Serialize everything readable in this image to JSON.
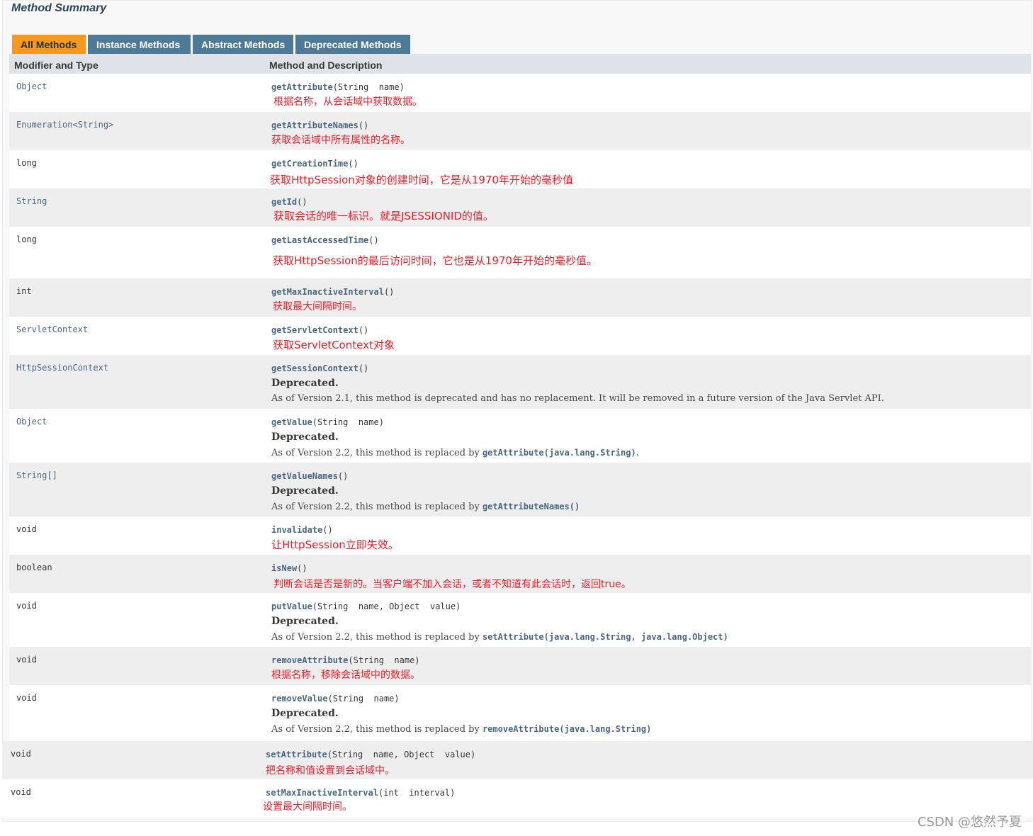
{
  "section_title": "Method Summary",
  "tabs": [
    {
      "label": "All Methods"
    },
    {
      "label": "Instance Methods"
    },
    {
      "label": "Abstract Methods"
    },
    {
      "label": "Deprecated Methods"
    }
  ],
  "headers": {
    "col1": "Modifier and Type",
    "col2": "Method and Description"
  },
  "rows": [
    {
      "type": "Object",
      "method": "getAttribute",
      "params": "(String  name)",
      "desc": "根据名称，从会话域中获取数据。"
    },
    {
      "type": "Enumeration<String>",
      "method": "getAttributeNames",
      "params": "()",
      "desc": "获取会话域中所有属性的名称。"
    },
    {
      "type": "long",
      "method": "getCreationTime",
      "params": "()",
      "desc": "获取HttpSession对象的创建时间，它是从1970年开始的毫秒值"
    },
    {
      "type": "String",
      "method": "getId",
      "params": "()",
      "desc": "获取会话的唯一标识。就是JSESSIONID的值。"
    },
    {
      "type": "long",
      "method": "getLastAccessedTime",
      "params": "()",
      "desc": "获取HttpSession的最后访问时间，它也是从1970年开始的毫秒值。"
    },
    {
      "type": "int",
      "method": "getMaxInactiveInterval",
      "params": "()",
      "desc": "获取最大间隔时间。"
    },
    {
      "type": "ServletContext",
      "method": "getServletContext",
      "params": "()",
      "desc": "获取ServletContext对象"
    },
    {
      "type": "HttpSessionContext",
      "method": "getSessionContext",
      "params": "()",
      "deprecated_label": "Deprecated.",
      "deprecated_note": "As of Version 2.1, this method is deprecated and has no replacement. It will be removed in a future version of the Java Servlet API."
    },
    {
      "type": "Object",
      "method": "getValue",
      "params": "(String  name)",
      "deprecated_label": "Deprecated.",
      "deprecated_note": "As of Version 2.2, this method is replaced by ",
      "deprecated_code": "getAttribute(java.lang.String)",
      "deprecated_tail": "."
    },
    {
      "type": "String[]",
      "method": "getValueNames",
      "params": "()",
      "deprecated_label": "Deprecated.",
      "deprecated_note": "As of Version 2.2, this method is replaced by ",
      "deprecated_code": "getAttributeNames()"
    },
    {
      "type": "void",
      "method": "invalidate",
      "params": "()",
      "desc": "让HttpSession立即失效。"
    },
    {
      "type": "boolean",
      "method": "isNew",
      "params": "()",
      "desc": "判断会话是否是新的。当客户端不加入会话，或者不知道有此会话时，返回true。"
    },
    {
      "type": "void",
      "method": "putValue",
      "params": "(String  name, Object  value)",
      "deprecated_label": "Deprecated.",
      "deprecated_note": "As of Version 2.2, this method is replaced by ",
      "deprecated_code": "setAttribute(java.lang.String, java.lang.Object)"
    },
    {
      "type": "void",
      "method": "removeAttribute",
      "params": "(String  name)",
      "desc": "根据名称，移除会话域中的数据。"
    },
    {
      "type": "void",
      "method": "removeValue",
      "params": "(String  name)",
      "deprecated_label": "Deprecated.",
      "deprecated_note": "As of Version 2.2, this method is replaced by ",
      "deprecated_code": "removeAttribute(java.lang.String)"
    },
    {
      "type": "void",
      "method": "setAttribute",
      "params": "(String  name, Object  value)",
      "desc": "把名称和值设置到会话域中。"
    },
    {
      "type": "void",
      "method": "setMaxInactiveInterval",
      "params": "(int  interval)",
      "desc": "设置最大间隔时间。"
    }
  ],
  "watermark": "CSDN @悠然予夏"
}
